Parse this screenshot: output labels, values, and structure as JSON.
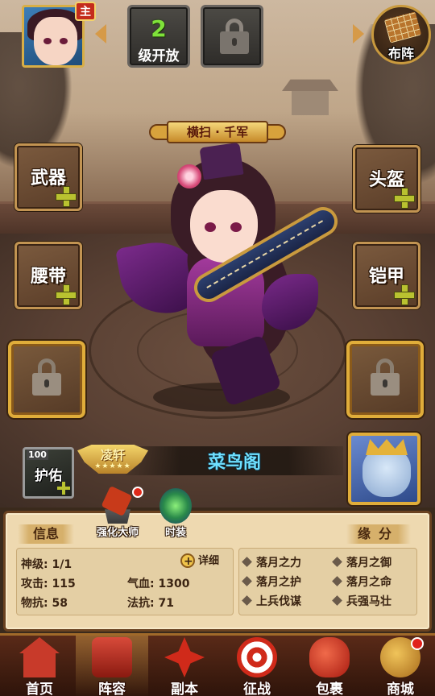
{
  "top": {
    "main_badge": "主",
    "slot_unlock": {
      "level": "2",
      "text": "级开放"
    },
    "formation_label": "布阵"
  },
  "hero": {
    "skill_name": "横扫 · 千军",
    "name": "菜鸟阁",
    "rank": "凌轩",
    "stars": "★★★★★"
  },
  "equipment": {
    "weapon": "武器",
    "helmet": "头盔",
    "belt": "腰带",
    "armor": "铠甲"
  },
  "guard": {
    "level": "100",
    "label": "护佑"
  },
  "shortcuts": {
    "forge": "强化大师",
    "fashion": "时装"
  },
  "panel": {
    "info_tab": "信息",
    "fate_tab": "缘分",
    "detail_label": "详细",
    "stats": [
      {
        "key": "神级:",
        "value": "1/1"
      },
      {
        "key": "攻击:",
        "value": "115"
      },
      {
        "key": "气血:",
        "value": "1300"
      },
      {
        "key": "物抗:",
        "value": "58"
      },
      {
        "key": "法抗:",
        "value": "71"
      }
    ],
    "fates": [
      "落月之力",
      "落月之御",
      "落月之护",
      "落月之命",
      "上兵伐谋",
      "兵强马壮"
    ]
  },
  "nav": {
    "items": [
      {
        "label": "首页",
        "icon": "home-icon"
      },
      {
        "label": "阵容",
        "icon": "team-icon"
      },
      {
        "label": "副本",
        "icon": "dungeon-icon"
      },
      {
        "label": "征战",
        "icon": "battle-icon"
      },
      {
        "label": "包裹",
        "icon": "bag-icon"
      },
      {
        "label": "商城",
        "icon": "shop-icon"
      }
    ],
    "active": "阵容"
  }
}
